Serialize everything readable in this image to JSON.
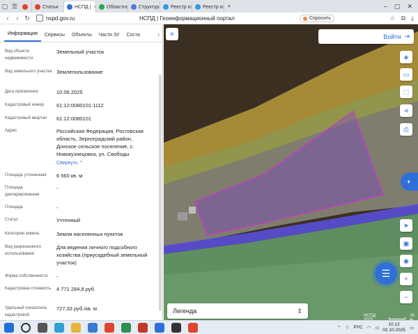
{
  "browser": {
    "tabs": [
      {
        "label": "",
        "color": "#e0442f",
        "active": false
      },
      {
        "label": "Статьи",
        "color": "#e0442f",
        "active": false
      },
      {
        "label": "НСПД |",
        "color": "#2f6fd8",
        "active": true
      },
      {
        "label": "Областно",
        "color": "#2fa84f",
        "active": false
      },
      {
        "label": "Структура",
        "color": "#4a7ad8",
        "active": false
      },
      {
        "label": "Реестр изс",
        "color": "#2f9fd8",
        "active": false
      },
      {
        "label": "Реестр изс",
        "color": "#2f9fd8",
        "active": false
      }
    ],
    "url": "nspd.gov.ru",
    "page_title": "НСПД | Геоинформационный портал",
    "ask_label": "Спросить"
  },
  "panel": {
    "tabs": [
      "Информация",
      "Сервисы",
      "Объекты",
      "Части ЗУ",
      "Соста"
    ],
    "rows": [
      {
        "label": "Вид объекта недвижимости",
        "value": "Земельный участок"
      },
      {
        "label": "Вид земельного участка",
        "value": "Землепользование"
      },
      {
        "label": "Дата присвоения",
        "value": "10.06.2025"
      },
      {
        "label": "Кадастровый номер",
        "value": "61:12:0080101:1112"
      },
      {
        "label": "Кадастровый квартал",
        "value": "61:12:0080101"
      },
      {
        "label": "Адрес",
        "value": "Российская Федерация, Ростовская область, Зерноградский район, Донское сельское поселение, с. Новокузнецовка, ул. Свободы"
      },
      {
        "label": "Площадь уточненная",
        "value": "6 560 кв. м"
      },
      {
        "label": "Площадь декларированная",
        "value": "-"
      },
      {
        "label": "Площадь",
        "value": "-"
      },
      {
        "label": "Статус",
        "value": "Учтенный"
      },
      {
        "label": "Категория земель",
        "value": "Земли населенных пунктов"
      },
      {
        "label": "Вид разрешенного использования",
        "value": "Для ведения личного подсобного хозяйства (приусадебный земельный участок)"
      },
      {
        "label": "Форма собственности",
        "value": "-"
      },
      {
        "label": "Кадастровая стоимость",
        "value": "4 771 284,8 руб."
      },
      {
        "label": "Удельный показатель кадастровой",
        "value": "727,33 руб./кв. м"
      }
    ],
    "collapse_link": "Свернуть"
  },
  "map": {
    "login_label": "Войти",
    "legend_label": "Легенда",
    "attribution": "НСПД 2025",
    "scale_label": "20 м",
    "parcel_color": "#7a3ad8"
  },
  "taskbar": {
    "lang": "РУС",
    "time": "10:12",
    "date": "02.10.2025"
  }
}
